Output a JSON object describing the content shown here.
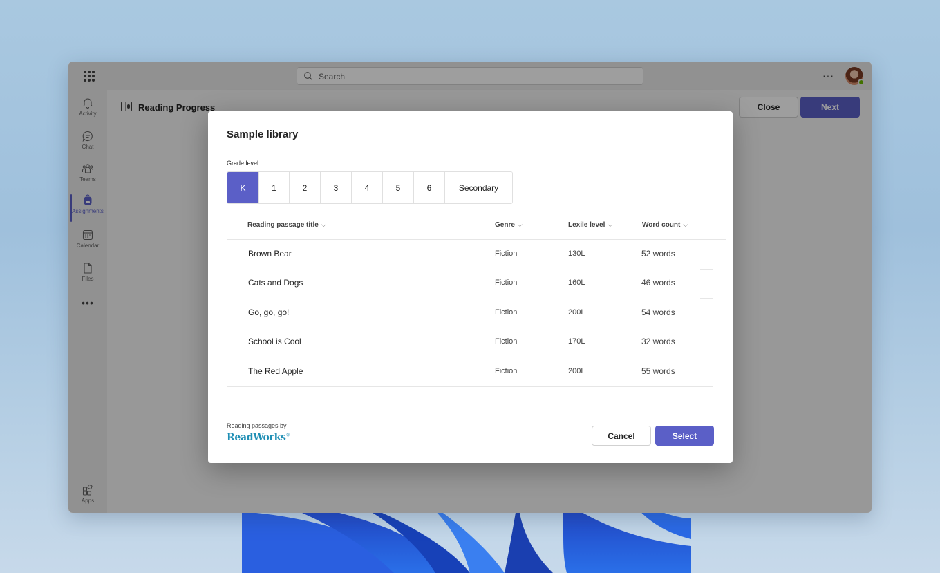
{
  "search": {
    "placeholder": "Search"
  },
  "rail": {
    "items": [
      {
        "label": "Activity",
        "icon": "bell-icon"
      },
      {
        "label": "Chat",
        "icon": "chat-icon"
      },
      {
        "label": "Teams",
        "icon": "teams-icon"
      },
      {
        "label": "Assignments",
        "icon": "backpack-icon",
        "active": true
      },
      {
        "label": "Calendar",
        "icon": "calendar-icon"
      },
      {
        "label": "Files",
        "icon": "file-icon"
      }
    ],
    "more": "•••",
    "apps": {
      "label": "Apps",
      "icon": "apps-icon"
    }
  },
  "header": {
    "app_title": "Reading Progress",
    "close_label": "Close",
    "next_label": "Next",
    "more": "···"
  },
  "dialog": {
    "title": "Sample library",
    "grade_label": "Grade level",
    "grades": [
      "K",
      "1",
      "2",
      "3",
      "4",
      "5",
      "6",
      "Secondary"
    ],
    "selected_grade": "K",
    "columns": [
      "Reading passage title",
      "Genre",
      "Lexile level",
      "Word count"
    ],
    "rows": [
      {
        "title": "Brown Bear",
        "genre": "Fiction",
        "lexile": "130L",
        "words": "52 words"
      },
      {
        "title": "Cats and Dogs",
        "genre": "Fiction",
        "lexile": "160L",
        "words": "46 words"
      },
      {
        "title": "Go, go, go!",
        "genre": "Fiction",
        "lexile": "200L",
        "words": "54 words"
      },
      {
        "title": "School is Cool",
        "genre": "Fiction",
        "lexile": "170L",
        "words": "32 words"
      },
      {
        "title": "The Red Apple",
        "genre": "Fiction",
        "lexile": "200L",
        "words": "55 words"
      }
    ],
    "attribution": "Reading passages by",
    "brand": "ReadWorks",
    "brand_mark": "®",
    "cancel_label": "Cancel",
    "select_label": "Select"
  },
  "colors": {
    "accent": "#5b5fc7",
    "brand_readworks": "#1f8fb5",
    "presence_available": "#6bb700"
  }
}
